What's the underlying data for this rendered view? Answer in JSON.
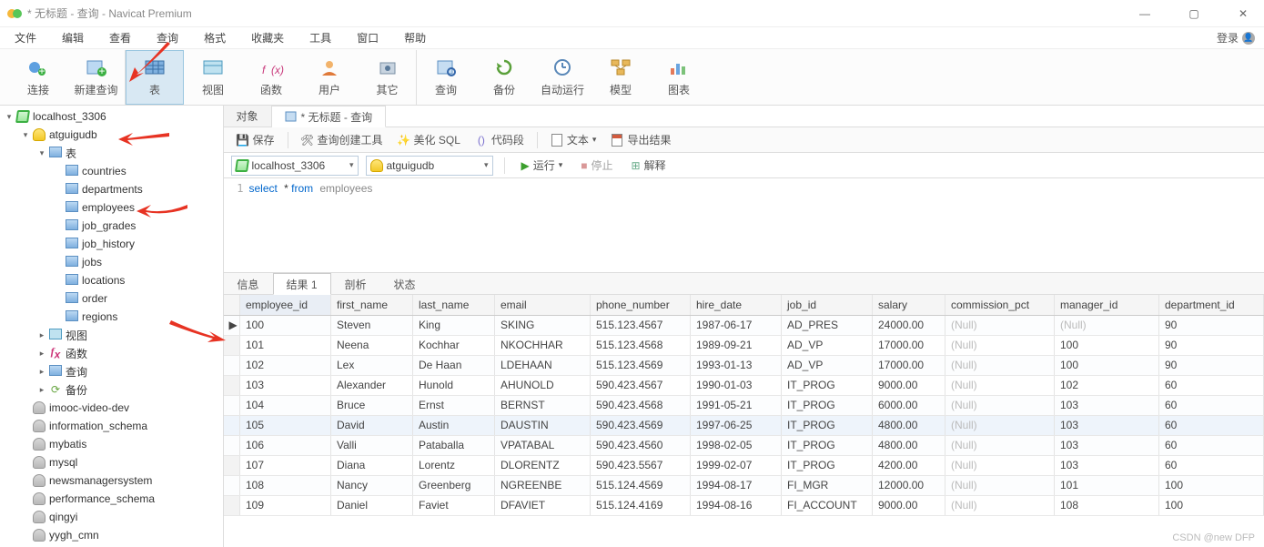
{
  "window": {
    "title": "* 无标题 - 查询 - Navicat Premium"
  },
  "menubar": {
    "items": [
      "文件",
      "编辑",
      "查看",
      "查询",
      "格式",
      "收藏夹",
      "工具",
      "窗口",
      "帮助"
    ],
    "login": "登录"
  },
  "toolbar": {
    "items": [
      {
        "label": "连接",
        "icon": "plug"
      },
      {
        "label": "新建查询",
        "icon": "newquery"
      },
      {
        "label": "表",
        "icon": "table",
        "active": true
      },
      {
        "label": "视图",
        "icon": "view"
      },
      {
        "label": "函数",
        "icon": "fx"
      },
      {
        "label": "用户",
        "icon": "user"
      },
      {
        "label": "其它",
        "icon": "other"
      },
      {
        "label": "查询",
        "icon": "query"
      },
      {
        "label": "备份",
        "icon": "backup"
      },
      {
        "label": "自动运行",
        "icon": "auto"
      },
      {
        "label": "模型",
        "icon": "model"
      },
      {
        "label": "图表",
        "icon": "chart"
      }
    ]
  },
  "sidebar": {
    "nodes": [
      {
        "depth": 0,
        "label": "localhost_3306",
        "icon": "conn",
        "twist": "▾"
      },
      {
        "depth": 1,
        "label": "atguigudb",
        "icon": "db",
        "twist": "▾"
      },
      {
        "depth": 2,
        "label": "表",
        "icon": "tbl",
        "twist": "▾"
      },
      {
        "depth": 3,
        "label": "countries",
        "icon": "tbl",
        "twist": ""
      },
      {
        "depth": 3,
        "label": "departments",
        "icon": "tbl",
        "twist": ""
      },
      {
        "depth": 3,
        "label": "employees",
        "icon": "tbl",
        "twist": ""
      },
      {
        "depth": 3,
        "label": "job_grades",
        "icon": "tbl",
        "twist": ""
      },
      {
        "depth": 3,
        "label": "job_history",
        "icon": "tbl",
        "twist": ""
      },
      {
        "depth": 3,
        "label": "jobs",
        "icon": "tbl",
        "twist": ""
      },
      {
        "depth": 3,
        "label": "locations",
        "icon": "tbl",
        "twist": ""
      },
      {
        "depth": 3,
        "label": "order",
        "icon": "tbl",
        "twist": ""
      },
      {
        "depth": 3,
        "label": "regions",
        "icon": "tbl",
        "twist": ""
      },
      {
        "depth": 2,
        "label": "视图",
        "icon": "view",
        "twist": "▸"
      },
      {
        "depth": 2,
        "label": "函数",
        "icon": "fx",
        "twist": "▸"
      },
      {
        "depth": 2,
        "label": "查询",
        "icon": "query",
        "twist": "▸"
      },
      {
        "depth": 2,
        "label": "备份",
        "icon": "backup",
        "twist": "▸"
      },
      {
        "depth": 1,
        "label": "imooc-video-dev",
        "icon": "dbg",
        "twist": ""
      },
      {
        "depth": 1,
        "label": "information_schema",
        "icon": "dbg",
        "twist": ""
      },
      {
        "depth": 1,
        "label": "mybatis",
        "icon": "dbg",
        "twist": ""
      },
      {
        "depth": 1,
        "label": "mysql",
        "icon": "dbg",
        "twist": ""
      },
      {
        "depth": 1,
        "label": "newsmanagersystem",
        "icon": "dbg",
        "twist": ""
      },
      {
        "depth": 1,
        "label": "performance_schema",
        "icon": "dbg",
        "twist": ""
      },
      {
        "depth": 1,
        "label": "qingyi",
        "icon": "dbg",
        "twist": ""
      },
      {
        "depth": 1,
        "label": "yygh_cmn",
        "icon": "dbg",
        "twist": ""
      }
    ]
  },
  "content_tabs": {
    "tabs": [
      {
        "label": "对象",
        "active": false
      },
      {
        "label": "* 无标题 - 查询",
        "active": true,
        "icon": "query"
      }
    ]
  },
  "querybar": {
    "save": "保存",
    "builder": "查询创建工具",
    "beautify": "美化 SQL",
    "snippet": "代码段",
    "text": "文本",
    "export": "导出结果"
  },
  "connbar": {
    "conn": "localhost_3306",
    "db": "atguigudb",
    "run": "运行",
    "stop": "停止",
    "explain": "解释"
  },
  "editor": {
    "line": "1",
    "sql": {
      "select": "select",
      "star": "*",
      "from": "from",
      "ident": "employees"
    }
  },
  "result_tabs": {
    "tabs": [
      "信息",
      "结果 1",
      "剖析",
      "状态"
    ],
    "active": 1
  },
  "grid": {
    "columns": [
      "employee_id",
      "first_name",
      "last_name",
      "email",
      "phone_number",
      "hire_date",
      "job_id",
      "salary",
      "commission_pct",
      "manager_id",
      "department_id"
    ],
    "sorted": 0,
    "rows": [
      {
        "c": [
          100,
          "Steven",
          "King",
          "SKING",
          "515.123.4567",
          "1987-06-17",
          "AD_PRES",
          "24000.00",
          null,
          null,
          90
        ],
        "cur": true
      },
      {
        "c": [
          101,
          "Neena",
          "Kochhar",
          "NKOCHHAR",
          "515.123.4568",
          "1989-09-21",
          "AD_VP",
          "17000.00",
          null,
          100,
          90
        ]
      },
      {
        "c": [
          102,
          "Lex",
          "De Haan",
          "LDEHAAN",
          "515.123.4569",
          "1993-01-13",
          "AD_VP",
          "17000.00",
          null,
          100,
          90
        ]
      },
      {
        "c": [
          103,
          "Alexander",
          "Hunold",
          "AHUNOLD",
          "590.423.4567",
          "1990-01-03",
          "IT_PROG",
          "9000.00",
          null,
          102,
          60
        ]
      },
      {
        "c": [
          104,
          "Bruce",
          "Ernst",
          "BERNST",
          "590.423.4568",
          "1991-05-21",
          "IT_PROG",
          "6000.00",
          null,
          103,
          60
        ]
      },
      {
        "c": [
          105,
          "David",
          "Austin",
          "DAUSTIN",
          "590.423.4569",
          "1997-06-25",
          "IT_PROG",
          "4800.00",
          null,
          103,
          60
        ],
        "hl": true
      },
      {
        "c": [
          106,
          "Valli",
          "Pataballa",
          "VPATABAL",
          "590.423.4560",
          "1998-02-05",
          "IT_PROG",
          "4800.00",
          null,
          103,
          60
        ]
      },
      {
        "c": [
          107,
          "Diana",
          "Lorentz",
          "DLORENTZ",
          "590.423.5567",
          "1999-02-07",
          "IT_PROG",
          "4200.00",
          null,
          103,
          60
        ]
      },
      {
        "c": [
          108,
          "Nancy",
          "Greenberg",
          "NGREENBE",
          "515.124.4569",
          "1994-08-17",
          "FI_MGR",
          "12000.00",
          null,
          101,
          100
        ]
      },
      {
        "c": [
          109,
          "Daniel",
          "Faviet",
          "DFAVIET",
          "515.124.4169",
          "1994-08-16",
          "FI_ACCOUNT",
          "9000.00",
          null,
          108,
          100
        ]
      }
    ],
    "null_label": "(Null)"
  },
  "watermark": "CSDN @new DFP"
}
